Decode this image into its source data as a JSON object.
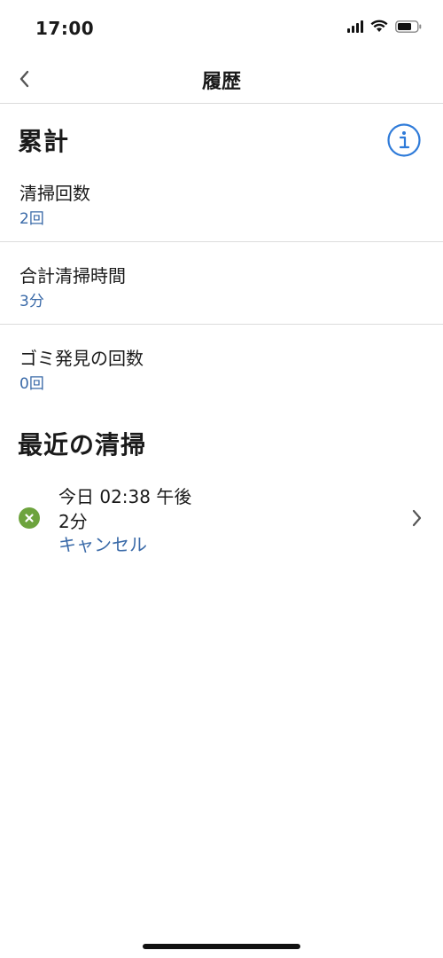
{
  "status_bar": {
    "time": "17:00"
  },
  "nav": {
    "title": "履歴"
  },
  "summary": {
    "title": "累計",
    "items": [
      {
        "label": "清掃回数",
        "value": "2回"
      },
      {
        "label": "合計清掃時間",
        "value": "3分"
      },
      {
        "label": "ゴミ発見の回数",
        "value": "0回"
      }
    ]
  },
  "recent": {
    "title": "最近の清掃",
    "items": [
      {
        "date": "今日 02:38 午後",
        "duration": "2分",
        "status": "キャンセル"
      }
    ]
  },
  "colors": {
    "accent": "#3a6aa8",
    "status_green": "#6da33d",
    "info_blue": "#2f7bd9"
  }
}
